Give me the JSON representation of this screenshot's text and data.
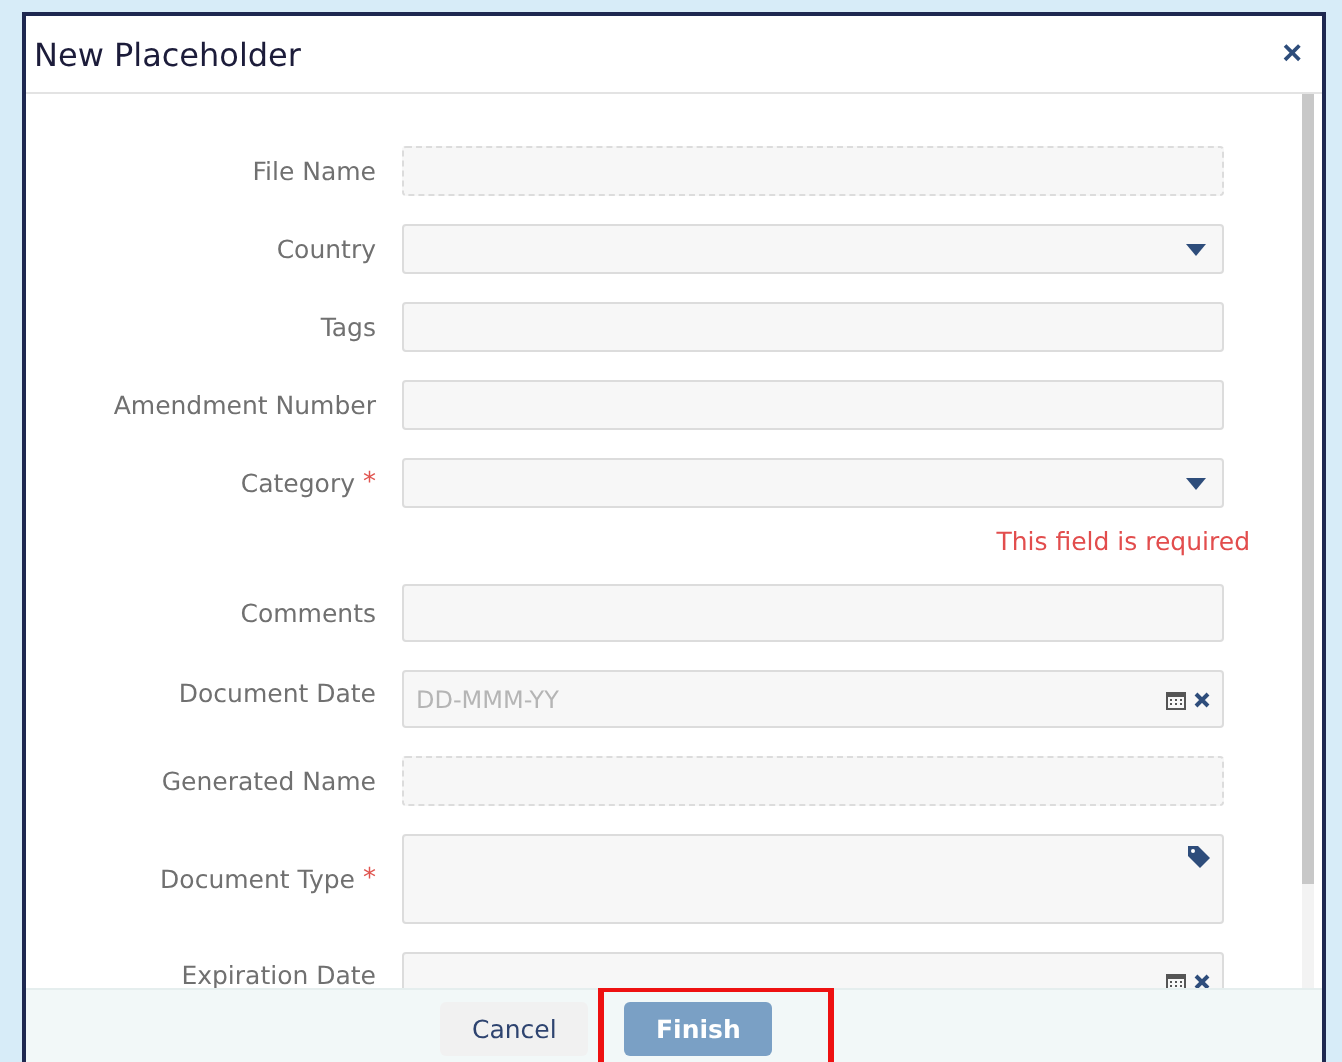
{
  "dialog": {
    "title": "New Placeholder",
    "close": "×",
    "required_mark": "*"
  },
  "fields": [
    {
      "label": "File Name",
      "kind": "readonly",
      "required": false
    },
    {
      "label": "Country",
      "kind": "select",
      "required": false
    },
    {
      "label": "Tags",
      "kind": "text",
      "required": false
    },
    {
      "label": "Amendment Number",
      "kind": "text",
      "required": false
    },
    {
      "label": "Category",
      "kind": "select",
      "required": true,
      "error": "This field is required"
    },
    {
      "label": "Comments",
      "kind": "tall",
      "required": false
    },
    {
      "label": "Document Date",
      "kind": "date",
      "required": false,
      "placeholder": "DD-MMM-YY"
    },
    {
      "label": "Generated Name",
      "kind": "readonly",
      "required": false
    },
    {
      "label": "Document Type",
      "kind": "tag",
      "required": true
    },
    {
      "label": "Expiration Date",
      "kind": "date",
      "required": false
    }
  ],
  "footer": {
    "buttons": [
      {
        "label": "Cancel",
        "kind": "secondary",
        "highlighted": false
      },
      {
        "label": "Finish",
        "kind": "primary",
        "highlighted": true
      }
    ]
  }
}
